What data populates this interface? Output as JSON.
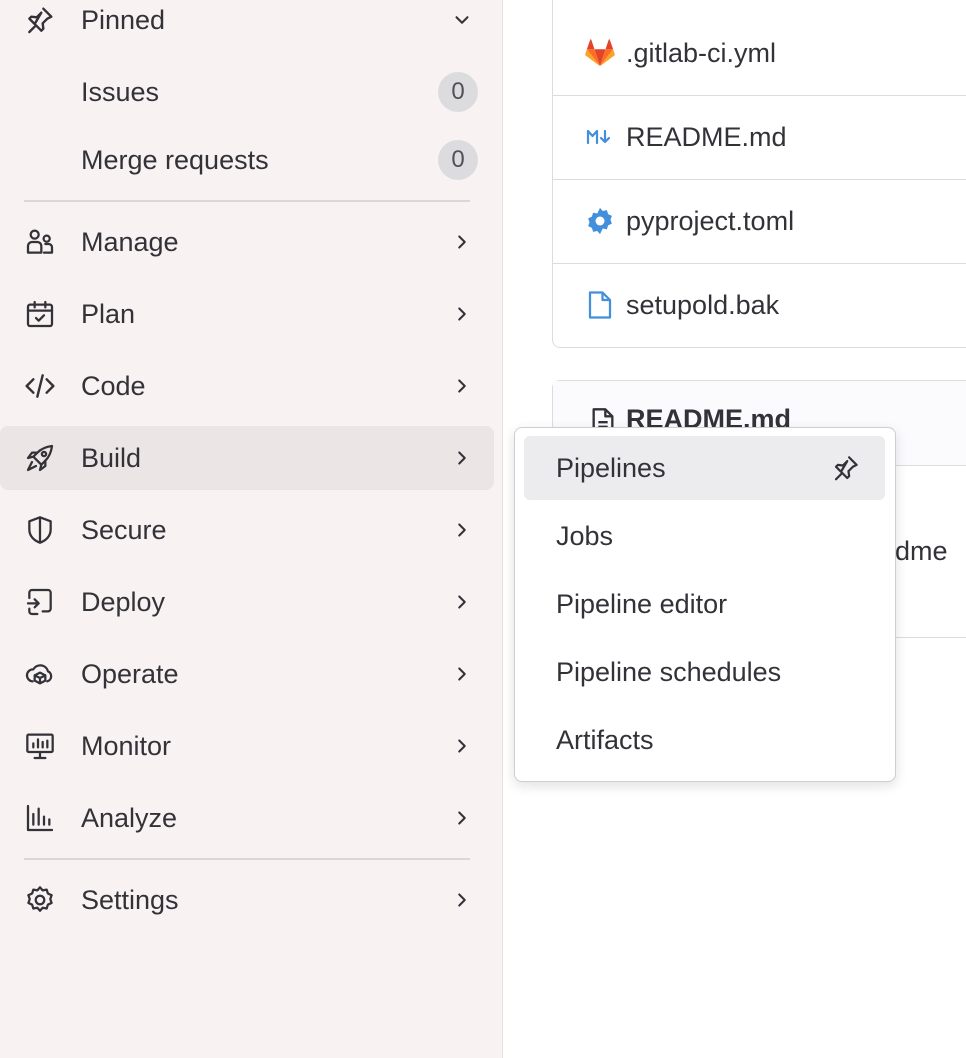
{
  "sidebar": {
    "pinned": {
      "label": "Pinned",
      "icon": "pin-icon",
      "expanded": true
    },
    "pinned_items": [
      {
        "label": "Issues",
        "count": "0"
      },
      {
        "label": "Merge requests",
        "count": "0"
      }
    ],
    "nav": [
      {
        "label": "Manage",
        "icon": "users-icon"
      },
      {
        "label": "Plan",
        "icon": "calendar-icon"
      },
      {
        "label": "Code",
        "icon": "code-icon"
      },
      {
        "label": "Build",
        "icon": "rocket-icon",
        "active": true
      },
      {
        "label": "Secure",
        "icon": "shield-icon"
      },
      {
        "label": "Deploy",
        "icon": "deploy-icon"
      },
      {
        "label": "Operate",
        "icon": "cloud-icon"
      },
      {
        "label": "Monitor",
        "icon": "monitor-icon"
      },
      {
        "label": "Analyze",
        "icon": "chart-icon"
      }
    ],
    "settings": {
      "label": "Settings",
      "icon": "gear-icon"
    }
  },
  "files": [
    {
      "name": ".gitlab-ci.yml",
      "icon": "gitlab-icon"
    },
    {
      "name": "README.md",
      "icon": "markdown-icon"
    },
    {
      "name": "pyproject.toml",
      "icon": "settings-file-icon"
    },
    {
      "name": "setupold.bak",
      "icon": "file-icon"
    }
  ],
  "readme": {
    "title": "README.md",
    "text_fragment": "adme"
  },
  "build_menu": {
    "items": [
      {
        "label": "Pipelines",
        "hover": true
      },
      {
        "label": "Jobs"
      },
      {
        "label": "Pipeline editor"
      },
      {
        "label": "Pipeline schedules"
      },
      {
        "label": "Artifacts"
      }
    ]
  },
  "colors": {
    "sidebar_bg": "#f8f2f2",
    "active_bg": "#ebe5e5",
    "file_icon_blue": "#428fdc",
    "gitlab_orange": "#e24329"
  }
}
